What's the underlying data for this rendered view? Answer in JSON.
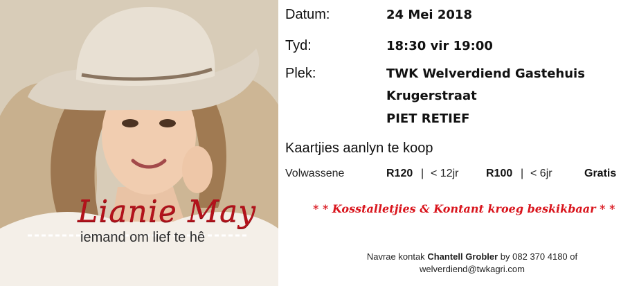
{
  "poster": {
    "artist_name": "Lianie May",
    "album_title": "iemand om lief te hê"
  },
  "event": {
    "date_label": "Datum:",
    "date_value": "24 Mei 2018",
    "time_label": "Tyd:",
    "time_value": "18:30 vir 19:00",
    "place_label": "Plek:",
    "place_line1": "TWK Welverdiend Gastehuis",
    "place_line2": "Krugerstraat",
    "place_line3": "PIET RETIEF"
  },
  "tickets": {
    "heading": "Kaartjies aanlyn te koop",
    "adult_label": "Volwassene",
    "adult_price": "R120",
    "sep1": "|",
    "child_label": "< 12jr",
    "child_price": "R100",
    "sep2": "|",
    "infant_label": "< 6jr",
    "infant_price": "Gratis"
  },
  "promo": "* * Kosstalletjies & Kontant kroeg beskikbaar * *",
  "contact": {
    "prefix": "Navrae kontak",
    "name": "Chantell Grobler",
    "middle": "by 082 370 4180 of",
    "email": "welverdiend@twkagri.com"
  }
}
